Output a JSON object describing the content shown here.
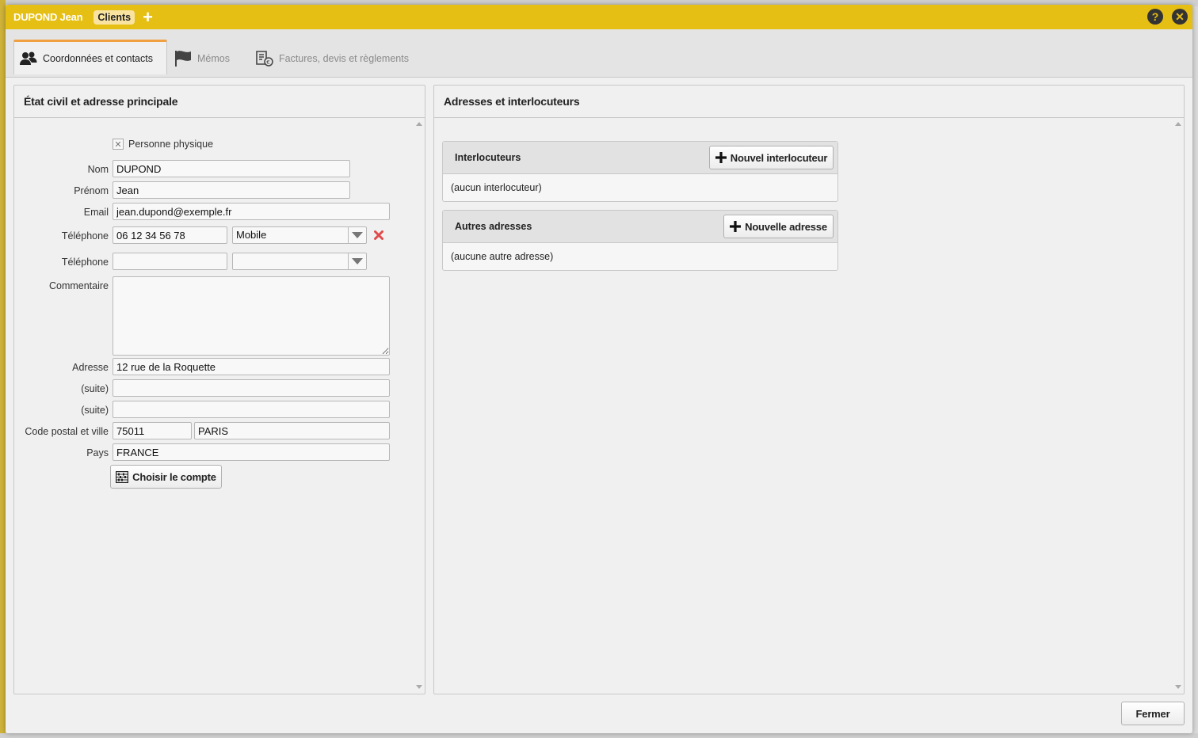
{
  "titlebar": {
    "record_name": "DUPOND Jean",
    "module_chip": "Clients",
    "add_glyph": "+",
    "help_glyph": "?",
    "close_glyph": "✕",
    "accent_color": "#e6bf14"
  },
  "tabs": [
    {
      "label": "Coordonnées et contacts",
      "icon": "contacts-icon",
      "active": true
    },
    {
      "label": "Mémos",
      "icon": "flag-icon",
      "active": false
    },
    {
      "label": "Factures, devis et règlements",
      "icon": "invoice-icon",
      "active": false
    }
  ],
  "left_panel": {
    "title": "État civil et adresse principale",
    "personne_physique_label": "Personne physique",
    "nom": {
      "label": "Nom",
      "value": "DUPOND"
    },
    "prenom": {
      "label": "Prénom",
      "value": "Jean"
    },
    "email": {
      "label": "Email",
      "value": "jean.dupond@exemple.fr"
    },
    "phone1": {
      "label": "Téléphone",
      "value": "06 12 34 56 78",
      "type": "Mobile"
    },
    "phone2": {
      "label": "Téléphone",
      "value": "",
      "type": ""
    },
    "commentaire": {
      "label": "Commentaire",
      "value": ""
    },
    "adresse": {
      "label": "Adresse",
      "value": "12 rue de la Roquette"
    },
    "suite1": {
      "label": "(suite)",
      "value": ""
    },
    "suite2": {
      "label": "(suite)",
      "value": ""
    },
    "cp_ville": {
      "label": "Code postal et ville",
      "cp": "75011",
      "ville": "PARIS"
    },
    "pays": {
      "label": "Pays",
      "value": "FRANCE"
    },
    "choose_account_label": "Choisir le compte"
  },
  "right_panel": {
    "title": "Adresses et interlocuteurs",
    "interlocuteurs": {
      "title": "Interlocuteurs",
      "button": "Nouvel interlocuteur",
      "empty": "(aucun interlocuteur)"
    },
    "autres_adresses": {
      "title": "Autres adresses",
      "button": "Nouvelle adresse",
      "empty": "(aucune autre adresse)"
    }
  },
  "footer": {
    "close_label": "Fermer"
  }
}
